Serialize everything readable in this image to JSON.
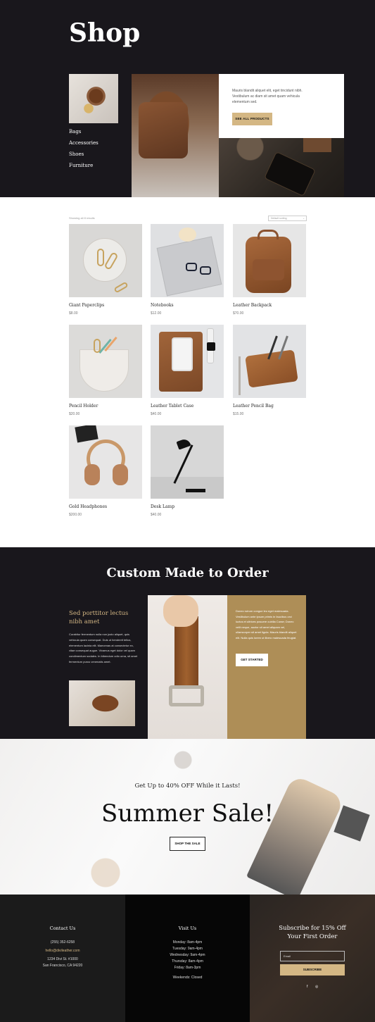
{
  "hero": {
    "title": "Shop",
    "nav": [
      "Bags",
      "Accessories",
      "Shoes",
      "Furniture"
    ],
    "card_text": "Mauris blandit aliquet elit, eget tincidunt nibh. Vestibulum ac diam sit amet quam vehicula elementum sed.",
    "card_button": "SEE ALL PRODUCTS"
  },
  "shop": {
    "results": "Showing all 8 results",
    "sort": "Default sorting",
    "products": [
      {
        "name": "Giant Paperclips",
        "price": "$8.00"
      },
      {
        "name": "Notebooks",
        "price": "$12.00"
      },
      {
        "name": "Leather Backpack",
        "price": "$70.00"
      },
      {
        "name": "Pencil Holder",
        "price": "$20.00"
      },
      {
        "name": "Leather Tablet Case",
        "price": "$40.00"
      },
      {
        "name": "Leather Pencil Bag",
        "price": "$15.00"
      },
      {
        "name": "Gold Headphones",
        "price": "$200.00"
      },
      {
        "name": "Desk Lamp",
        "price": "$40.00"
      }
    ]
  },
  "custom": {
    "title": "Custom Made to Order",
    "subtitle": "Sed porttitor lectus nibh amet",
    "body": "Curabitur fermentum nulla non justo aliquet, quis vehicula quam consequat. Duis ut hendrerit tellus, elementum lacinia elit. Maecenas at consectetur ex, vitae consequat augue. Vivamus eget dolor vel quam condimentum sodales. In bibendum odio urna, sit amet fermentum purus venenatis amet.",
    "gold_text": "Donec rutrum congue leo eget malesuada. Vestibulum ante ipsum primis in faucibus orci luctus et ultrices posuere cubilia Curae; Donec velit neque, auctor sit amet aliquam vel, ullamcorper sit amet ligula. Mauris blandit aliquet elit. Nulla quis lorem ut libero malesuada feugiat.",
    "button": "GET STARTED"
  },
  "sale": {
    "subtitle": "Get Up to 40% OFF While it Lasts!",
    "title": "Summer Sale!",
    "button": "SHOP THE SALE"
  },
  "footer": {
    "contact": {
      "title": "Contact Us",
      "phone": "(255) 352-6258",
      "email": "hello@divileather.com",
      "address1": "1234 Divi St. #1000",
      "address2": "San Francisco, CA 94220"
    },
    "visit": {
      "title": "Visit Us",
      "hours": [
        "Monday: 8am-4pm",
        "Tuesday: 9am-4pm",
        "Wednesday: 9am-4pm",
        "Thursday: 8am-4pm",
        "Friday: 8am-3pm"
      ],
      "weekends": "Weekends: Closed"
    },
    "subscribe": {
      "title": "Subscribe for 15% Off Your First Order",
      "placeholder": "Email",
      "button": "SUBSCRIBE",
      "social": [
        "f",
        "◎"
      ]
    }
  },
  "colors": {
    "dark": "#19171c",
    "gold": "#d4b784",
    "gold_panel": "#ae8e57"
  }
}
